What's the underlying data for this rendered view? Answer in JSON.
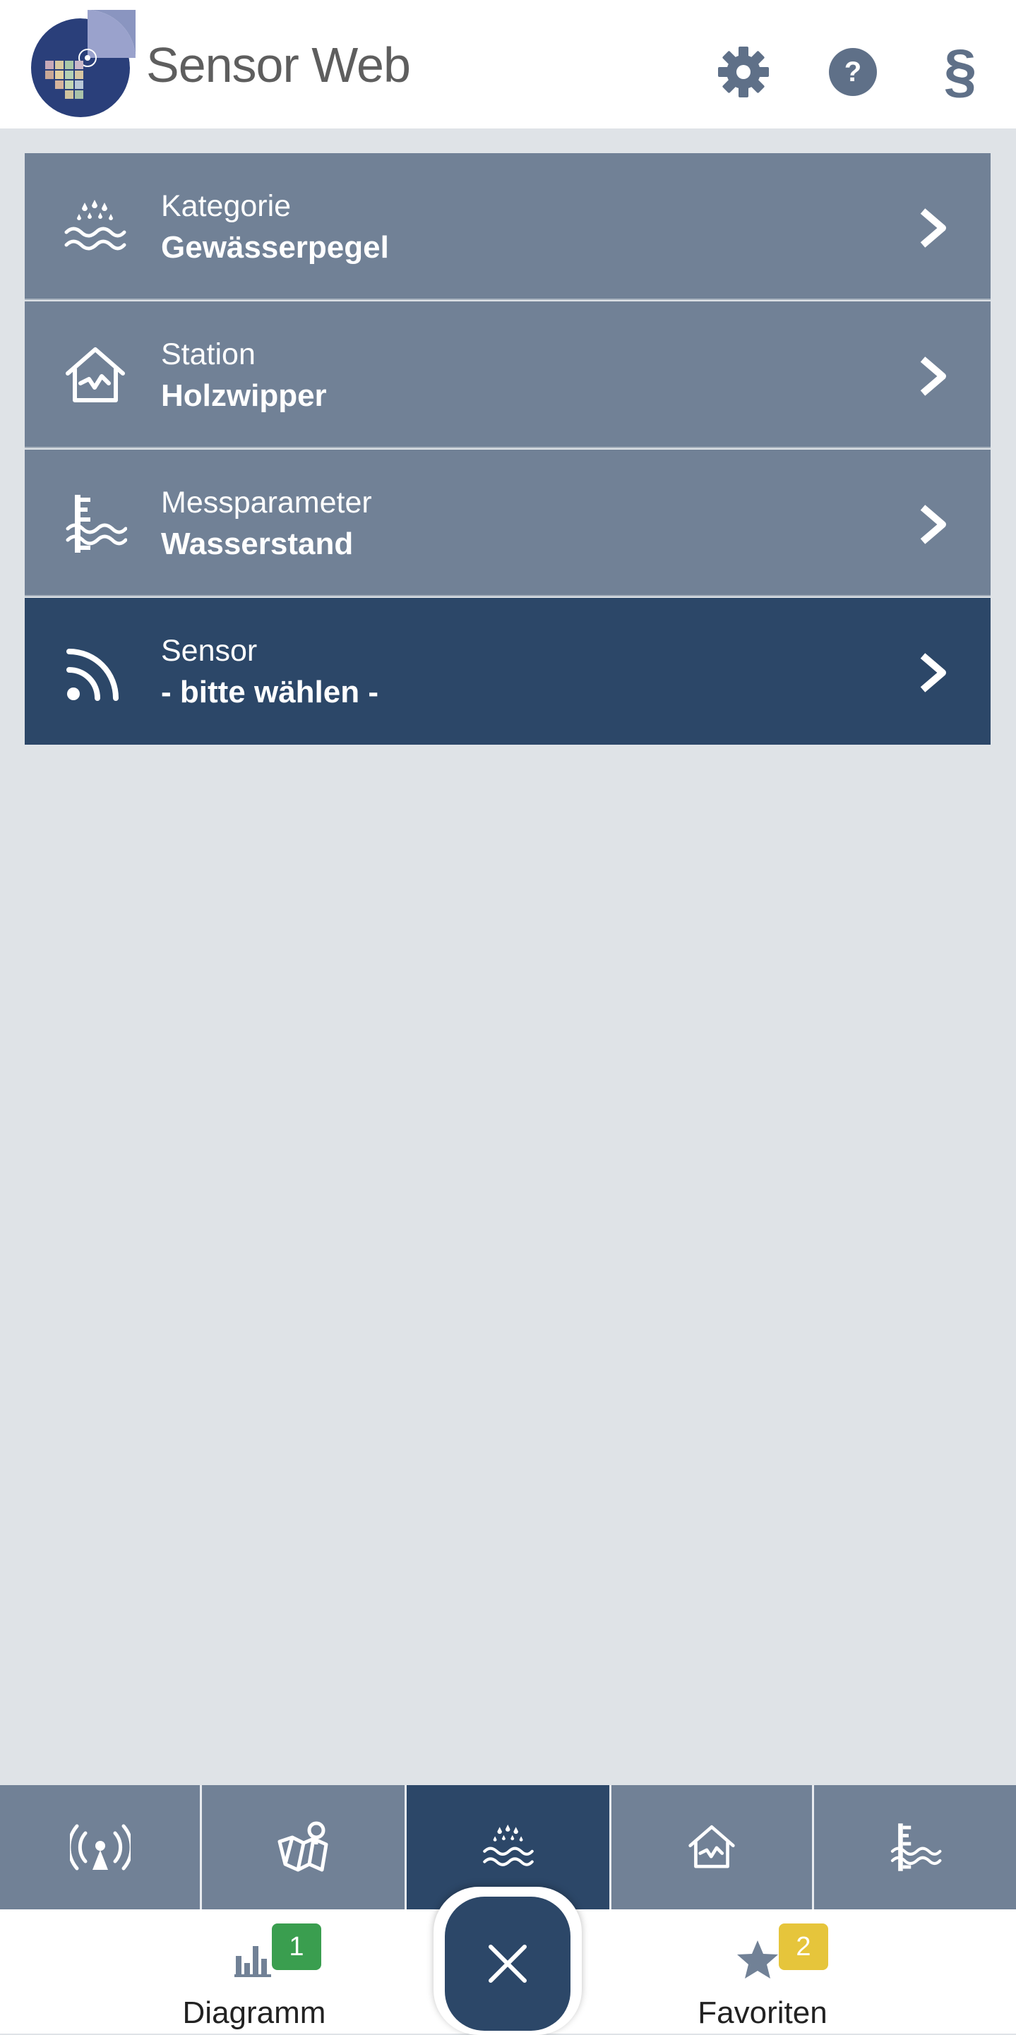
{
  "header": {
    "app_name": "Sensor Web",
    "settings_icon": "gear-icon",
    "help_icon": "help-icon",
    "legal_icon": "paragraph-icon",
    "legal_symbol": "§",
    "help_symbol": "?"
  },
  "selection": {
    "rows": [
      {
        "label": "Kategorie",
        "value": "Gewässerpegel",
        "icon": "water-rain-icon",
        "active": false
      },
      {
        "label": "Station",
        "value": "Holzwipper",
        "icon": "house-icon",
        "active": false
      },
      {
        "label": "Messparameter",
        "value": "Wasserstand",
        "icon": "water-level-icon",
        "active": false
      },
      {
        "label": "Sensor",
        "value": "- bitte wählen -",
        "icon": "rss-icon",
        "active": true
      }
    ]
  },
  "tabs": [
    {
      "icon": "antenna-icon",
      "active": false
    },
    {
      "icon": "map-pin-icon",
      "active": false
    },
    {
      "icon": "water-rain-icon",
      "active": true
    },
    {
      "icon": "house-icon",
      "active": false
    },
    {
      "icon": "water-level-icon",
      "active": false
    }
  ],
  "footer": {
    "diagram_label": "Diagramm",
    "diagram_badge": "1",
    "favorites_label": "Favoriten",
    "favorites_badge": "2",
    "close_icon": "close-icon"
  },
  "colors": {
    "row_bg": "#718196",
    "active_bg": "#2c4768",
    "page_bg": "#dfe3e7",
    "icon_gray": "#5f7088",
    "badge_green": "#3a9e4f",
    "badge_yellow": "#e6c53b"
  }
}
